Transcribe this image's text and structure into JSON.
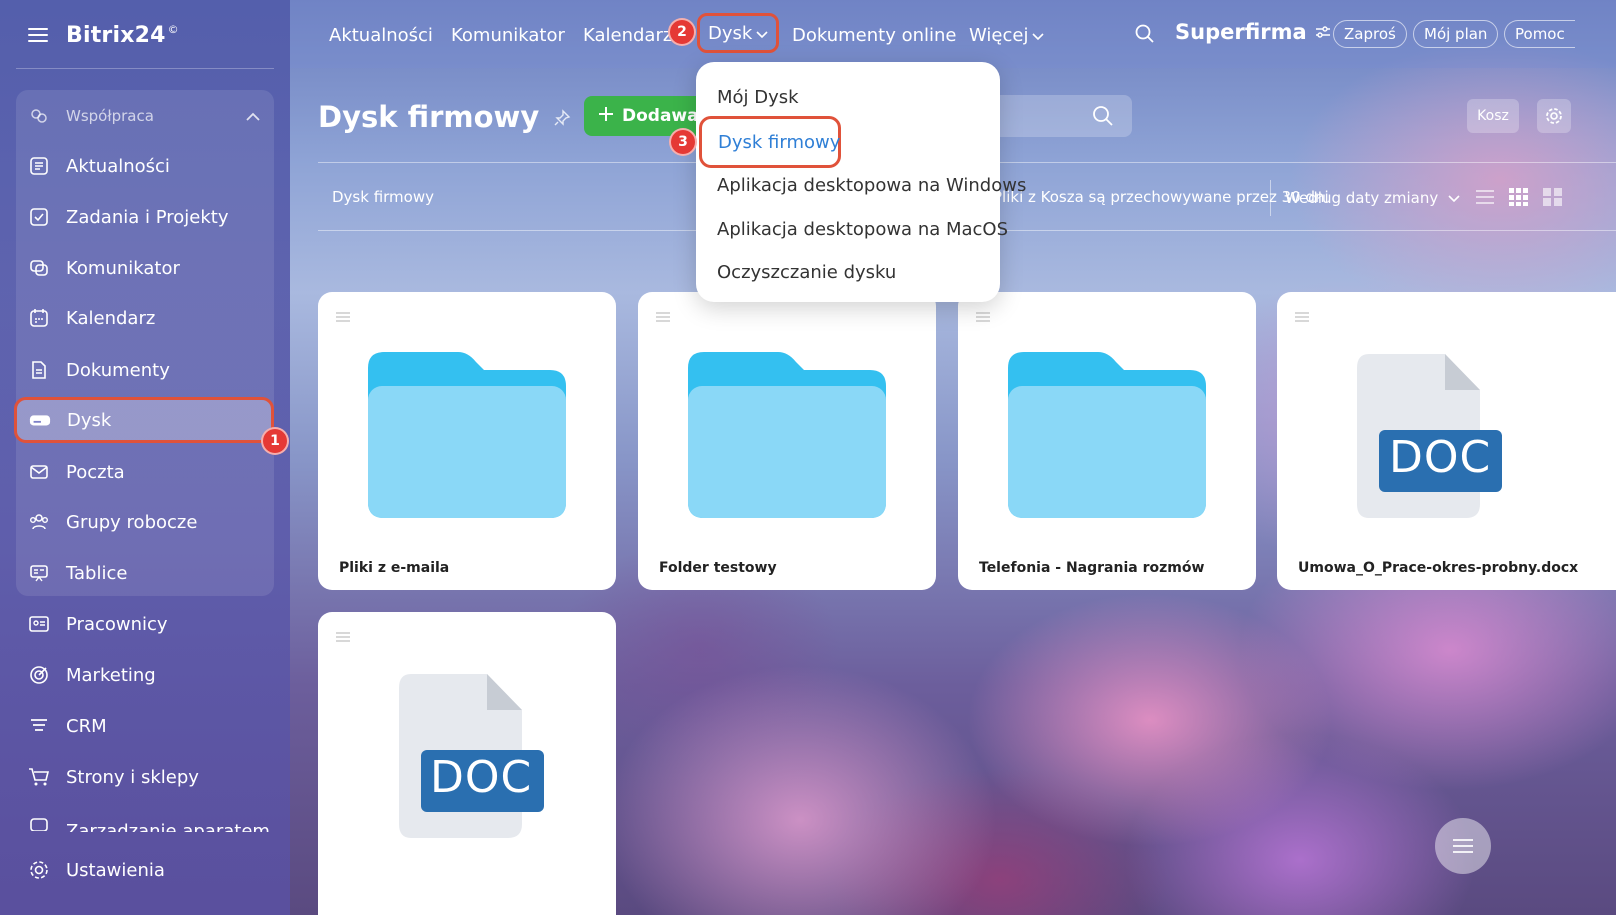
{
  "brand": {
    "name": "Bitrix24",
    "mark": "©"
  },
  "sidebar": {
    "group_label": "Współpraca",
    "items": [
      {
        "label": "Aktualności",
        "icon": "news-icon"
      },
      {
        "label": "Zadania i Projekty",
        "icon": "tasks-icon"
      },
      {
        "label": "Komunikator",
        "icon": "chat-icon"
      },
      {
        "label": "Kalendarz",
        "icon": "calendar-icon"
      },
      {
        "label": "Dokumenty",
        "icon": "document-icon"
      },
      {
        "label": "Dysk",
        "icon": "drive-icon"
      },
      {
        "label": "Poczta",
        "icon": "mail-icon"
      },
      {
        "label": "Grupy robocze",
        "icon": "groups-icon"
      },
      {
        "label": "Tablice",
        "icon": "boards-icon"
      },
      {
        "label": "Pracownicy",
        "icon": "employees-icon"
      },
      {
        "label": "Marketing",
        "icon": "marketing-icon"
      },
      {
        "label": "CRM",
        "icon": "crm-icon"
      },
      {
        "label": "Strony i sklepy",
        "icon": "cart-icon"
      },
      {
        "label": "Zarządzanie aparatem",
        "icon": "device-icon"
      },
      {
        "label": "Ustawienia",
        "icon": "settings-icon"
      }
    ]
  },
  "topbar": {
    "nav": [
      "Aktualności",
      "Komunikator",
      "Kalendarz",
      "Dysk",
      "Dokumenty online",
      "Więcej"
    ],
    "company": "Superfirma",
    "invite": "Zaproś",
    "plan": "Mój plan",
    "help": "Pomoc"
  },
  "page": {
    "title": "Dysk firmowy",
    "add_button": "Dodawanie",
    "trash": "Kosz",
    "breadcrumb": "Dysk firmowy",
    "notice": "Pliki z Kosza są przechowywane przez 30 dni",
    "sort": "Według daty zmiany"
  },
  "dropdown": {
    "items": [
      "Mój Dysk",
      "Dysk firmowy",
      "Aplikacja desktopowa na Windows",
      "Aplikacja desktopowa na MacOS",
      "Oczyszczanie dysku"
    ]
  },
  "files": [
    {
      "name": "Pliki z e-maila",
      "type": "folder"
    },
    {
      "name": "Folder testowy",
      "type": "folder"
    },
    {
      "name": "Telefonia - Nagrania rozmów",
      "type": "folder"
    },
    {
      "name": "Umowa_O_Prace-okres-probny.docx",
      "type": "doc"
    },
    {
      "name": "",
      "type": "doc"
    }
  ],
  "doc_label": "DOC",
  "annotations": [
    "1",
    "2",
    "3"
  ],
  "colors": {
    "highlight": "#e0523a",
    "badge": "#e53935",
    "add": "#3bb34a",
    "folder": "#8ad8f7",
    "folder_tab": "#34c0f0",
    "doc": "#2a6fb0",
    "link": "#2f7fd6"
  }
}
